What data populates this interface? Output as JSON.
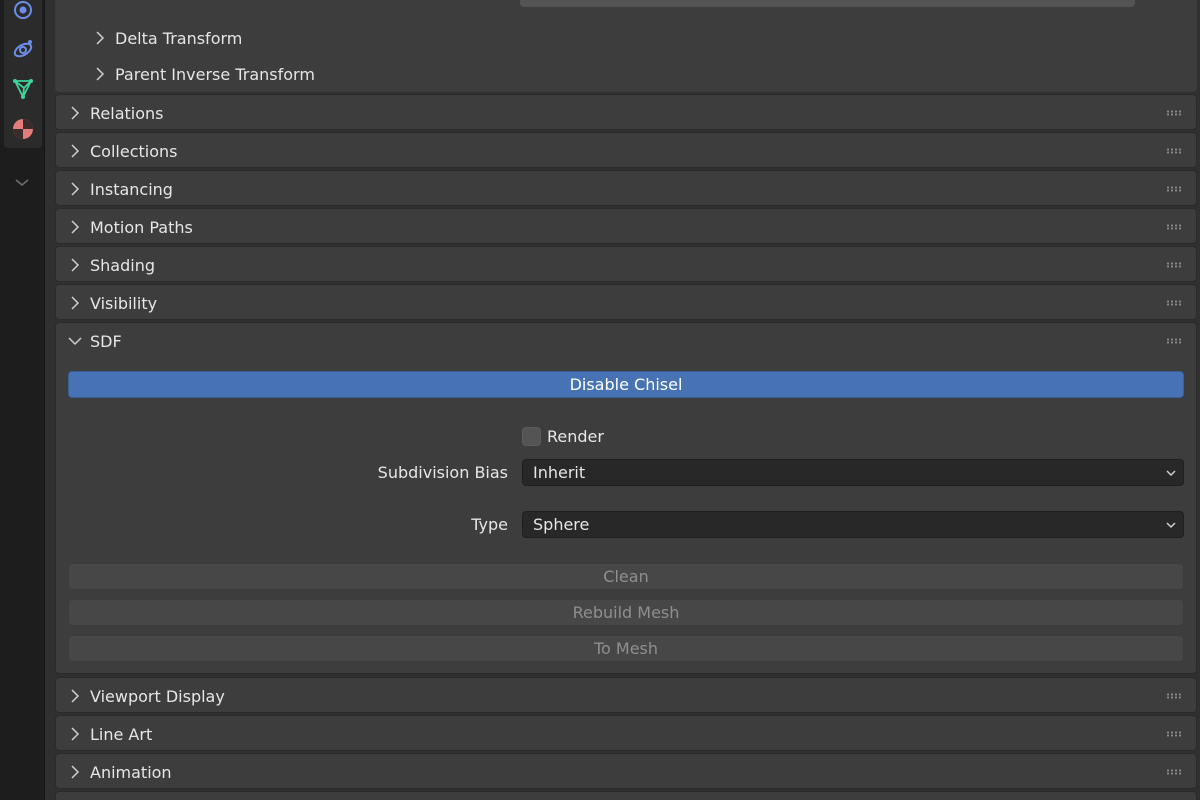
{
  "tabs": [
    {
      "icon": "physics-icon",
      "color": "#6b8ee8"
    },
    {
      "icon": "constraints-icon",
      "color": "#6b8ee8"
    },
    {
      "icon": "data-mesh-icon",
      "color": "#3fd39a"
    },
    {
      "icon": "material-icon",
      "color": "#e57c7c"
    }
  ],
  "top_subpanels": [
    {
      "label": "Delta Transform"
    },
    {
      "label": "Parent Inverse Transform"
    }
  ],
  "collapsed_panels_top": [
    {
      "label": "Relations"
    },
    {
      "label": "Collections"
    },
    {
      "label": "Instancing"
    },
    {
      "label": "Motion Paths"
    },
    {
      "label": "Shading"
    },
    {
      "label": "Visibility"
    }
  ],
  "sdf": {
    "title": "SDF",
    "disable_button": "Disable Chisel",
    "render_label": "Render",
    "render_checked": false,
    "subdivision_bias_label": "Subdivision Bias",
    "subdivision_bias_value": "Inherit",
    "type_label": "Type",
    "type_value": "Sphere",
    "clean_button": "Clean",
    "rebuild_button": "Rebuild Mesh",
    "to_mesh_button": "To Mesh"
  },
  "collapsed_panels_bottom": [
    {
      "label": "Viewport Display"
    },
    {
      "label": "Line Art"
    },
    {
      "label": "Animation"
    }
  ],
  "colors": {
    "accent": "#4772b3",
    "panel": "#3d3d3d",
    "background": "#303030"
  }
}
